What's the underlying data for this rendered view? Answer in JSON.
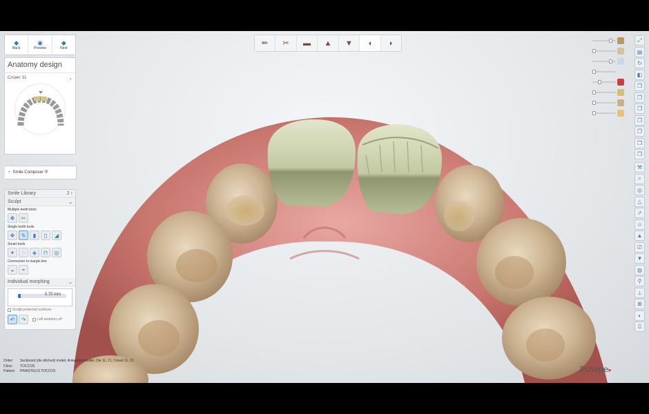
{
  "nav": {
    "back_label": "Back",
    "preview_label": "Preview",
    "next_label": "Next"
  },
  "anatomy": {
    "title": "Anatomy design",
    "crown_select": "Crown 11",
    "smile_composer": "Smile Composer ®"
  },
  "tools": {
    "smile_library": "Smile Library",
    "smile_library_num": "2",
    "sculpt": "Sculpt",
    "multiple_teeth": "Multiple teeth tools",
    "single_tooth": "Single tooth tools",
    "smart_tools": "Smart tools",
    "connection": "Connection to margin line",
    "individual_morphing": "Individual morphing",
    "morph_value": "0.70 mm",
    "morph_level_fraction": 0.06,
    "sculpt_protected": "Sculpt protected surfaces",
    "left_anatomy": "Left anatomy off"
  },
  "footer": {
    "order_key": "Order:",
    "order_val": "Sectioned (die ditched) model, Antagonist model, Die 11, 21, Crown 11, 21",
    "clinic_key": "Clinic:",
    "clinic_val": "TOCCOS",
    "patient_key": "Patient:",
    "patient_val": "PRAISTELIS TOCCOS"
  },
  "brand": {
    "logo_text": "3shape",
    "accent": "#2a78c7",
    "logo_accent": "#d04040"
  },
  "icons": {
    "toolbar": [
      "pen-margin-icon",
      "scissors-die-icon",
      "insertion-icon",
      "crown-up-icon",
      "crown-down-icon",
      "tooth-icon",
      "tooth-side-icon"
    ],
    "right": [
      "expand-icon",
      "layers-icon",
      "rotate-icon",
      "view-icon",
      "copy-icon",
      "copy-icon",
      "copy-icon",
      "copy-icon",
      "copy-icon",
      "copy-icon",
      "copy-icon",
      "tools-icon",
      "search-icon",
      "circle-icon",
      "triangle-icon",
      "arrow-icon",
      "face-icon",
      "up-icon",
      "check-icon",
      "down-icon",
      "globe-icon",
      "pin-icon",
      "measure-icon",
      "scale-icon",
      "palette-icon",
      "camera-icon"
    ]
  }
}
